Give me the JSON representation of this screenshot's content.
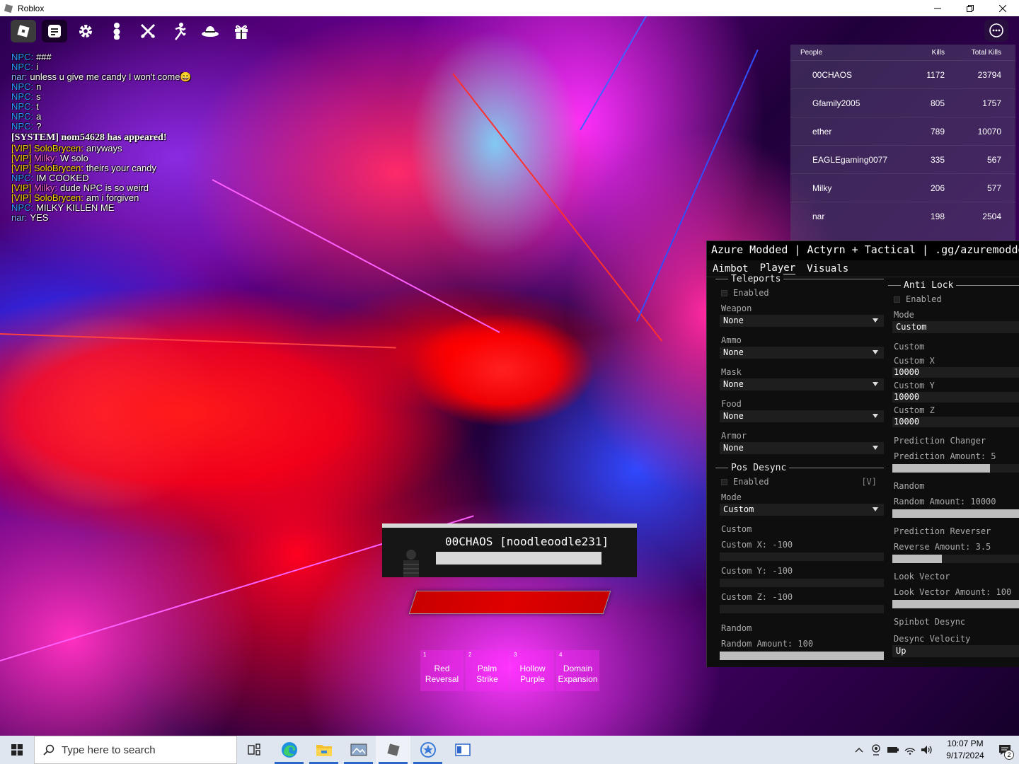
{
  "window": {
    "title": "Roblox"
  },
  "chat": {
    "lines": [
      {
        "name": "NPC:",
        "name_color": "#2d9bff",
        "text": "###"
      },
      {
        "name": "NPC:",
        "name_color": "#2d9bff",
        "text": "i"
      },
      {
        "name": "nar:",
        "name_color": "#8ab4ff",
        "text": "unless u give me candy I won't come😄"
      },
      {
        "name": "NPC:",
        "name_color": "#2d9bff",
        "text": "n"
      },
      {
        "name": "NPC:",
        "name_color": "#2d9bff",
        "text": "s"
      },
      {
        "name": "NPC:",
        "name_color": "#2d9bff",
        "text": "t"
      },
      {
        "name": "NPC:",
        "name_color": "#2d9bff",
        "text": "a"
      },
      {
        "name": "NPC:",
        "name_color": "#2d9bff",
        "text": "?"
      }
    ],
    "system_message": "[SYSTEM] nom54628 has appeared!",
    "lines2": [
      {
        "tag": "[VIP]",
        "name": "SoloBrycen:",
        "name_color": "#ffd400",
        "text": "anyways"
      },
      {
        "tag": "[VIP]",
        "name": "Milky:",
        "name_color": "#ff6ad5",
        "text": "W solo"
      },
      {
        "tag": "[VIP]",
        "name": "SoloBrycen:",
        "name_color": "#ffd400",
        "text": "theirs your candy"
      },
      {
        "tag": "",
        "name": "NPC:",
        "name_color": "#2d9bff",
        "text": "IM COOKED"
      },
      {
        "tag": "[VIP]",
        "name": "Milky:",
        "name_color": "#ff6ad5",
        "text": "dude NPC is so weird"
      },
      {
        "tag": "[VIP]",
        "name": "SoloBrycen:",
        "name_color": "#ffd400",
        "text": "am i forgiven"
      },
      {
        "tag": "",
        "name": "NPC:",
        "name_color": "#2d9bff",
        "text": "MILKY KILLEN ME"
      },
      {
        "tag": "",
        "name": "nar:",
        "name_color": "#8ab4ff",
        "text": "YES"
      }
    ]
  },
  "leaderboard": {
    "headers": {
      "people": "People",
      "kills": "Kills",
      "total": "Total Kills"
    },
    "rows": [
      {
        "name": "00CHAOS",
        "kills": "1172",
        "total": "23794"
      },
      {
        "name": "Gfamily2005",
        "kills": "805",
        "total": "1757"
      },
      {
        "name": "ether",
        "kills": "789",
        "total": "10070"
      },
      {
        "name": "EAGLEgaming0077",
        "kills": "335",
        "total": "567"
      },
      {
        "name": "Milky",
        "kills": "206",
        "total": "577"
      },
      {
        "name": "nar",
        "kills": "198",
        "total": "2504"
      }
    ]
  },
  "panel": {
    "title": "Azure Modded | Actyrn + Tactical | .gg/azuremodded",
    "tabs": [
      "Aimbot",
      "Player",
      "Visuals"
    ],
    "left": {
      "teleports": {
        "title": "Teleports",
        "enabled": "Enabled",
        "weapon_label": "Weapon",
        "weapon_value": "None",
        "ammo_label": "Ammo",
        "ammo_value": "None",
        "mask_label": "Mask",
        "mask_value": "None",
        "food_label": "Food",
        "food_value": "None",
        "armor_label": "Armor",
        "armor_value": "None"
      },
      "pos_desync": {
        "title": "Pos Desync",
        "enabled": "Enabled",
        "keybind": "[V]",
        "mode_label": "Mode",
        "mode_value": "Custom",
        "custom_label": "Custom",
        "custom_x": "Custom X: -100",
        "custom_y": "Custom Y: -100",
        "custom_z": "Custom Z: -100",
        "random_label": "Random",
        "random_amount": "Random Amount: 100",
        "random_fill": 1.0
      }
    },
    "right": {
      "anti_lock": {
        "title": "Anti Lock",
        "enabled": "Enabled",
        "mode_label": "Mode",
        "mode_value": "Custom",
        "custom_label": "Custom",
        "custom_x_label": "Custom X",
        "custom_x_value": "10000",
        "custom_y_label": "Custom Y",
        "custom_y_value": "10000",
        "custom_z_label": "Custom Z",
        "custom_z_value": "10000",
        "pred_changer": "Prediction Changer",
        "pred_amount": "Prediction Amount: 5",
        "pred_fill": 0.75,
        "random_label": "Random",
        "random_amount": "Random Amount: 10000",
        "random_fill": 1.0,
        "pred_reverser": "Prediction Reverser",
        "reverse_amount": "Reverse Amount: 3.5",
        "reverse_fill": 0.38,
        "look_vector": "Look Vector",
        "look_amount": "Look Vector Amount: 100",
        "look_fill": 1.0,
        "spinbot": "Spinbot Desync",
        "desync_velocity": "Desync Velocity",
        "velocity_value": "Up"
      }
    }
  },
  "target": {
    "name": "00CHAOS [noodleoodle231]",
    "hp_fill": 1.0
  },
  "hotbar": [
    {
      "num": "1",
      "name1": "Red",
      "name2": "Reversal"
    },
    {
      "num": "2",
      "name1": "Palm",
      "name2": "Strike"
    },
    {
      "num": "3",
      "name1": "Hollow",
      "name2": "Purple"
    },
    {
      "num": "4",
      "name1": "Domain",
      "name2": "Expansion"
    }
  ],
  "taskbar": {
    "search_placeholder": "Type here to search",
    "time": "10:07 PM",
    "date": "9/17/2024",
    "notifications": "2"
  }
}
